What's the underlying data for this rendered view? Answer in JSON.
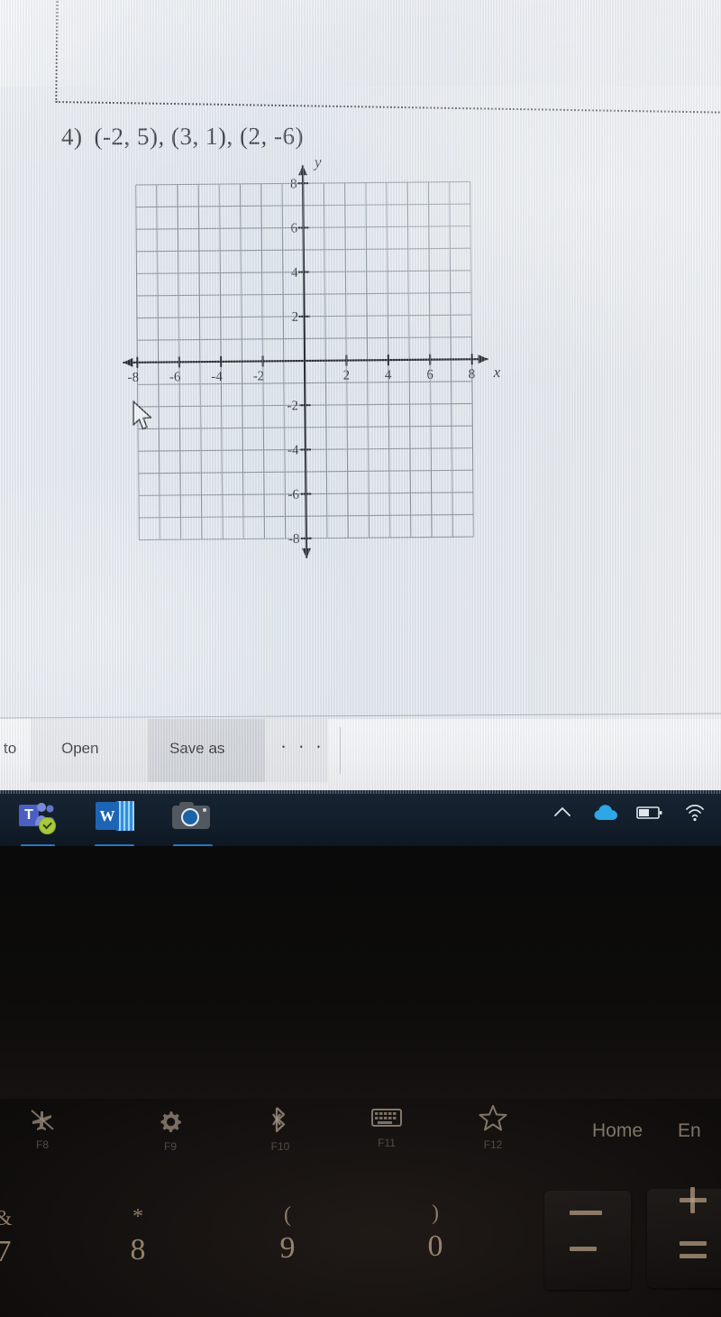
{
  "document": {
    "problem_number": "4)",
    "problem_text": "(-2, 5), (3, 1), (2, -6)",
    "separator": "dotted-line"
  },
  "chart_data": {
    "type": "scatter",
    "title": "",
    "xlabel": "x",
    "ylabel": "y",
    "xlim": [
      -9,
      9
    ],
    "ylim": [
      -9,
      9
    ],
    "grid": true,
    "legend": "none",
    "x_tick_labels": [
      "-8",
      "-6",
      "-4",
      "-2",
      "2",
      "4",
      "6",
      "8"
    ],
    "x_ticks": [
      -8,
      -6,
      -4,
      -2,
      2,
      4,
      6,
      8
    ],
    "y_tick_labels": [
      "8",
      "6",
      "4",
      "2",
      "-2",
      "-4",
      "-6",
      "-8"
    ],
    "y_ticks": [
      8,
      6,
      4,
      2,
      -2,
      -4,
      -6,
      -8
    ],
    "grid_x_range": [
      -8,
      8
    ],
    "grid_y_range": [
      -8,
      8
    ],
    "grid_step": 1,
    "points": [],
    "points_to_plot": [
      {
        "x": -2,
        "y": 5,
        "label": "(-2, 5)"
      },
      {
        "x": 3,
        "y": 1,
        "label": "(3, 1)"
      },
      {
        "x": 2,
        "y": -6,
        "label": "(2, -6)"
      }
    ],
    "note": "Blank coordinate grid; the listed ordered pairs are not yet plotted."
  },
  "cursor": {
    "name": "mouse-pointer",
    "graph_x": -7.5,
    "graph_y": -2.3
  },
  "notification_bar": {
    "message_fragment": "to",
    "open_label": "Open",
    "save_as_label": "Save as",
    "more_label": "· · ·"
  },
  "taskbar": {
    "background": "#14202e",
    "apps": [
      {
        "name": "microsoft-teams",
        "letter": "T",
        "badge": "checkmark",
        "running": true
      },
      {
        "name": "microsoft-word",
        "letter": "W",
        "running": true
      },
      {
        "name": "camera",
        "running": true
      }
    ],
    "tray": [
      {
        "name": "show-hidden-icons",
        "glyph": "chevron-up"
      },
      {
        "name": "onedrive",
        "glyph": "cloud",
        "color": "#29a8e0"
      },
      {
        "name": "battery",
        "glyph": "battery"
      },
      {
        "name": "wifi",
        "glyph": "wifi"
      }
    ]
  },
  "keyboard": {
    "function_row": [
      {
        "key": "F8",
        "glyph": "airplane-mode",
        "label": "F8"
      },
      {
        "key": "F9",
        "glyph": "settings-gear",
        "label": "F9"
      },
      {
        "key": "F10",
        "glyph": "bluetooth",
        "label": "F10"
      },
      {
        "key": "F11",
        "glyph": "keyboard-backlight",
        "label": "F11"
      },
      {
        "key": "F12",
        "glyph": "star",
        "label": "F12"
      },
      {
        "key": "Home",
        "label": "Home"
      },
      {
        "key": "End",
        "label": "En"
      }
    ],
    "number_row": [
      {
        "symbol": "&",
        "number": "7"
      },
      {
        "symbol": "*",
        "number": "8"
      },
      {
        "symbol": "(",
        "number": "9"
      },
      {
        "symbol": ")",
        "number": "0"
      },
      {
        "symbol": "_",
        "number": "-"
      },
      {
        "symbol": "+",
        "number": "="
      }
    ]
  }
}
